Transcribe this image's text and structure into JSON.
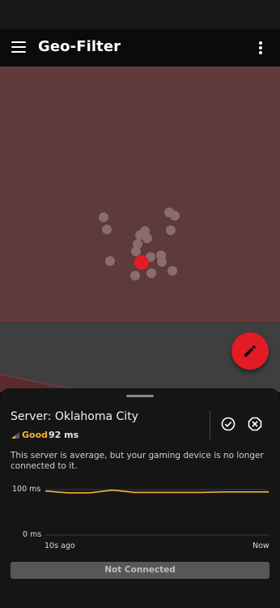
{
  "app": {
    "title": "Geo-Filter"
  },
  "icons": {
    "menu": "hamburger-menu-icon",
    "more": "more-vert-icon",
    "fab": "pencil-icon",
    "allow": "check-circle-icon",
    "block": "block-octagon-icon",
    "signal": "signal-strength-icon"
  },
  "colors": {
    "accent": "#e21b25",
    "quality": "#f2b33d",
    "chart_line": "#f2b33d",
    "map_region": "#5e3a3a"
  },
  "map": {
    "server_count_visible": 17
  },
  "server": {
    "title": "Server: Oklahoma City",
    "quality": "Good",
    "latency": "92 ms",
    "description": "This server is average, but your gaming device is no longer connected to it."
  },
  "chart_data": {
    "type": "line",
    "title": "",
    "xlabel": "",
    "ylabel": "",
    "x_tick_labels": [
      "10s ago",
      "Now"
    ],
    "y_tick_labels": [
      "100 ms",
      "0 ms"
    ],
    "ylim": [
      0,
      100
    ],
    "series": [
      {
        "values": [
          97,
          93,
          93,
          99,
          94,
          94,
          94,
          94,
          95,
          95,
          95
        ]
      }
    ]
  },
  "actions": {
    "connect_label": "Not Connected"
  }
}
